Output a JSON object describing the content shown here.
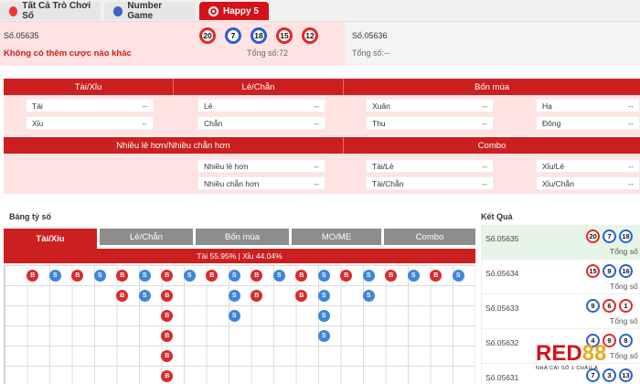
{
  "tabs": [
    {
      "label": "Tất Cả Trò Chơi Số"
    },
    {
      "label": "Number Game"
    },
    {
      "label": "Happy 5"
    }
  ],
  "draw": {
    "current_issue": "Số.05635",
    "message": "Không có thêm cược nào khác",
    "balls": [
      {
        "n": "20",
        "color": "red"
      },
      {
        "n": "7",
        "color": "blue"
      },
      {
        "n": "18",
        "color": "blue"
      },
      {
        "n": "15",
        "color": "red"
      },
      {
        "n": "12",
        "color": "red"
      }
    ],
    "total": "Tổng số:72",
    "next_issue": "Số.05636",
    "next_total": "Tổng số:--"
  },
  "stats1": {
    "headers": [
      "Tài/Xỉu",
      "Lẻ/Chẵn",
      "Bốn mùa"
    ],
    "cells": [
      {
        "label": "Tài",
        "value": "--"
      },
      {
        "label": "Xỉu",
        "value": "--"
      },
      {
        "label": "Lẻ",
        "value": "--"
      },
      {
        "label": "Chẵn",
        "value": "--"
      },
      {
        "label": "Xuân",
        "value": "--"
      },
      {
        "label": "Thu",
        "value": "--"
      },
      {
        "label": "Hạ",
        "value": "--"
      },
      {
        "label": "Đông",
        "value": "--"
      }
    ]
  },
  "stats2": {
    "headers": [
      "Nhiều lẻ hơn/Nhiều chẵn hơn",
      "Combo"
    ],
    "cells": [
      {
        "label": "Nhiều lẻ hơn",
        "value": "--"
      },
      {
        "label": "Nhiều chẵn hơn",
        "value": "--"
      },
      {
        "label": "Tài/Lẻ",
        "value": "--"
      },
      {
        "label": "Tài/Chẵn",
        "value": "--"
      },
      {
        "label": "Xỉu/Lẻ",
        "value": "--"
      },
      {
        "label": "Xỉu/Chẵn",
        "value": "--"
      }
    ]
  },
  "ratio": {
    "title": "Bảng tỷ số",
    "tabs": [
      "Tài/Xỉu",
      "Lẻ/Chẵn",
      "Bốn mùa",
      "MO/ME",
      "Combo"
    ],
    "summary": "Tài 55.95% | Xỉu 44.04%",
    "grid": [
      [
        "",
        "",
        "",
        "",
        "",
        "",
        ""
      ],
      [
        "B",
        "",
        "",
        "",
        "",
        "",
        ""
      ],
      [
        "S",
        "",
        "",
        "",
        "",
        "",
        ""
      ],
      [
        "B",
        "",
        "",
        "",
        "",
        "",
        ""
      ],
      [
        "S",
        "",
        "",
        "",
        "",
        "",
        ""
      ],
      [
        "B",
        "B",
        "",
        "",
        "",
        "",
        ""
      ],
      [
        "S",
        "S",
        "",
        "",
        "",
        "",
        ""
      ],
      [
        "B",
        "B",
        "B",
        "B",
        "B",
        "B",
        ""
      ],
      [
        "S",
        "",
        "",
        "",
        "",
        "",
        ""
      ],
      [
        "B",
        "",
        "",
        "",
        "",
        "",
        ""
      ],
      [
        "S",
        "S",
        "S",
        "",
        "",
        "",
        ""
      ],
      [
        "B",
        "B",
        "",
        "",
        "",
        "",
        ""
      ],
      [
        "S",
        "",
        "",
        "",
        "",
        "",
        ""
      ],
      [
        "B",
        "B",
        "",
        "",
        "",
        "",
        ""
      ],
      [
        "S",
        "S",
        "S",
        "S",
        "",
        "",
        ""
      ],
      [
        "B",
        "",
        "",
        "",
        "",
        "",
        ""
      ],
      [
        "S",
        "S",
        "",
        "",
        "",
        "",
        ""
      ],
      [
        "B",
        "",
        "",
        "",
        "",
        "",
        ""
      ],
      [
        "S",
        "",
        "",
        "",
        "",
        "",
        ""
      ],
      [
        "B",
        "",
        "",
        "",
        "",
        "",
        ""
      ],
      [
        "S",
        "",
        "",
        "",
        "",
        "",
        ""
      ]
    ]
  },
  "results": {
    "title": "Kết Quả",
    "rows": [
      {
        "issue": "Số.05635",
        "balls": [
          {
            "n": "20",
            "color": "red"
          },
          {
            "n": "7",
            "color": "blue"
          },
          {
            "n": "18",
            "color": "blue"
          }
        ],
        "total": "Tổng số"
      },
      {
        "issue": "Số.05634",
        "balls": [
          {
            "n": "15",
            "color": "red"
          },
          {
            "n": "9",
            "color": "blue"
          },
          {
            "n": "16",
            "color": "blue"
          }
        ],
        "total": "Tổng số"
      },
      {
        "issue": "Số.05633",
        "balls": [
          {
            "n": "9",
            "color": "blue"
          },
          {
            "n": "6",
            "color": "red"
          },
          {
            "n": "1",
            "color": "red"
          }
        ],
        "total": "Tổng số"
      },
      {
        "issue": "Số.05632",
        "balls": [
          {
            "n": "4",
            "color": "blue"
          },
          {
            "n": "9",
            "color": "red"
          },
          {
            "n": "8",
            "color": "blue"
          }
        ],
        "total": "Tổng số"
      },
      {
        "issue": "Số.05631",
        "balls": [
          {
            "n": "7",
            "color": "blue"
          },
          {
            "n": "3",
            "color": "blue"
          },
          {
            "n": "13",
            "color": "blue"
          }
        ],
        "total": ""
      }
    ]
  },
  "logo": {
    "part1": "RED",
    "part2": "88",
    "tagline": "NHÀ CÁI SỐ 1 CHÂU Á"
  },
  "colors": {
    "brand_red": "#cc1f1f",
    "big": "#d92b2b",
    "small": "#3d86d8",
    "highlight": "#ffe3e3"
  }
}
